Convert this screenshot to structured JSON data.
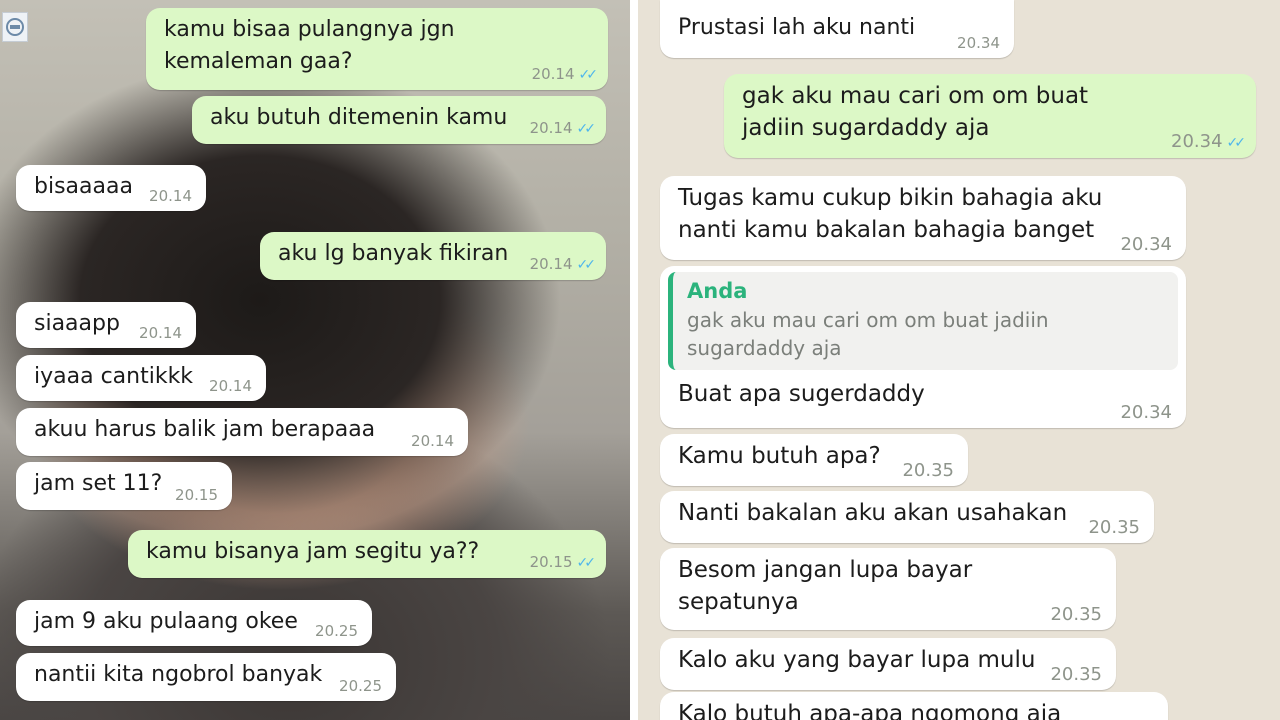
{
  "left_chat": {
    "messages": [
      {
        "dir": "out",
        "text": "kamu bisaa pulangnya jgn kemaleman gaa?",
        "time": "20.14",
        "ticks": "✓✓"
      },
      {
        "dir": "out",
        "text": "aku butuh ditemenin kamu",
        "time": "20.14",
        "ticks": "✓✓"
      },
      {
        "dir": "in",
        "text": "bisaaaaa",
        "time": "20.14"
      },
      {
        "dir": "out",
        "text": "aku lg banyak fikiran",
        "time": "20.14",
        "ticks": "✓✓"
      },
      {
        "dir": "in",
        "text": "siaaapp",
        "time": "20.14"
      },
      {
        "dir": "in",
        "text": "iyaaa cantikkk",
        "time": "20.14"
      },
      {
        "dir": "in",
        "text": "akuu harus balik jam berapaaa",
        "time": "20.14"
      },
      {
        "dir": "in",
        "text": "jam set 11?",
        "time": "20.15"
      },
      {
        "dir": "out",
        "text": "kamu bisanya jam segitu ya??",
        "time": "20.15",
        "ticks": "✓✓"
      },
      {
        "dir": "in",
        "text": "jam 9 aku pulaang okee",
        "time": "20.25"
      },
      {
        "dir": "in",
        "text": "nantii kita ngobrol banyak",
        "time": "20.25"
      }
    ]
  },
  "right_chat": {
    "messages": [
      {
        "dir": "in",
        "text": "Prustasi lah aku nanti",
        "time": "20.34"
      },
      {
        "dir": "out",
        "text": "gak aku mau cari om om buat jadiin sugardaddy aja",
        "time": "20.34",
        "ticks": "✓✓"
      },
      {
        "dir": "in",
        "text": "Tugas kamu cukup bikin bahagia aku nanti kamu bakalan bahagia banget",
        "time": "20.34"
      },
      {
        "dir": "in",
        "quote_author": "Anda",
        "quote_text": "gak aku mau cari om om buat jadiin sugardaddy aja",
        "text": "Buat apa sugerdaddy",
        "time": "20.34"
      },
      {
        "dir": "in",
        "text": "Kamu butuh apa?",
        "time": "20.35"
      },
      {
        "dir": "in",
        "text": "Nanti bakalan aku akan usahakan",
        "time": "20.35"
      },
      {
        "dir": "in",
        "text": "Besom jangan lupa bayar sepatunya",
        "time": "20.35"
      },
      {
        "dir": "in",
        "text": "Kalo aku yang bayar lupa mulu",
        "time": "20.35"
      },
      {
        "dir": "in",
        "text": "Kalo butuh apa-apa ngomong aja",
        "time": ""
      }
    ]
  },
  "colors": {
    "incoming_bubble": "#ffffff",
    "outgoing_bubble": "#dcf8c6",
    "read_ticks": "#4fb6ec",
    "quote_accent": "#2bb37c",
    "chat_wallpaper": "#e8e2d6"
  },
  "icons": {
    "corner": "camera-icon"
  }
}
